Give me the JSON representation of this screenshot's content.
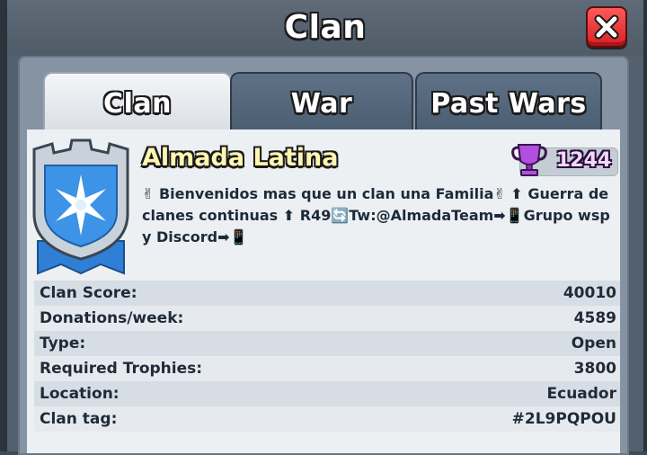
{
  "window": {
    "title": "Clan"
  },
  "tabs": [
    {
      "label": "Clan",
      "active": true
    },
    {
      "label": "War",
      "active": false
    },
    {
      "label": "Past Wars",
      "active": false
    }
  ],
  "clan": {
    "name": "Almada Latina",
    "trophies": "1244",
    "badge_icon": "star-shield-badge",
    "description": "✌ Bienvenidos mas que un clan una Familia✌ ⬆ Guerra de clanes continuas ⬆ R49🔄Tw:@AlmadaTeam➡📱Grupo wsp y Discord➡📱"
  },
  "stats": [
    {
      "label": "Clan Score:",
      "value": "40010"
    },
    {
      "label": "Donations/week:",
      "value": "4589"
    },
    {
      "label": "Type:",
      "value": "Open"
    },
    {
      "label": "Required Trophies:",
      "value": "3800"
    },
    {
      "label": "Location:",
      "value": "Ecuador"
    },
    {
      "label": "Clan tag:",
      "value": "#2L9PQPOU"
    }
  ],
  "colors": {
    "accent_close": "#d71f26",
    "clan_name": "#fff6b0",
    "trophy_purple": "#9c3fd0",
    "badge_blue": "#2f7fd6"
  }
}
